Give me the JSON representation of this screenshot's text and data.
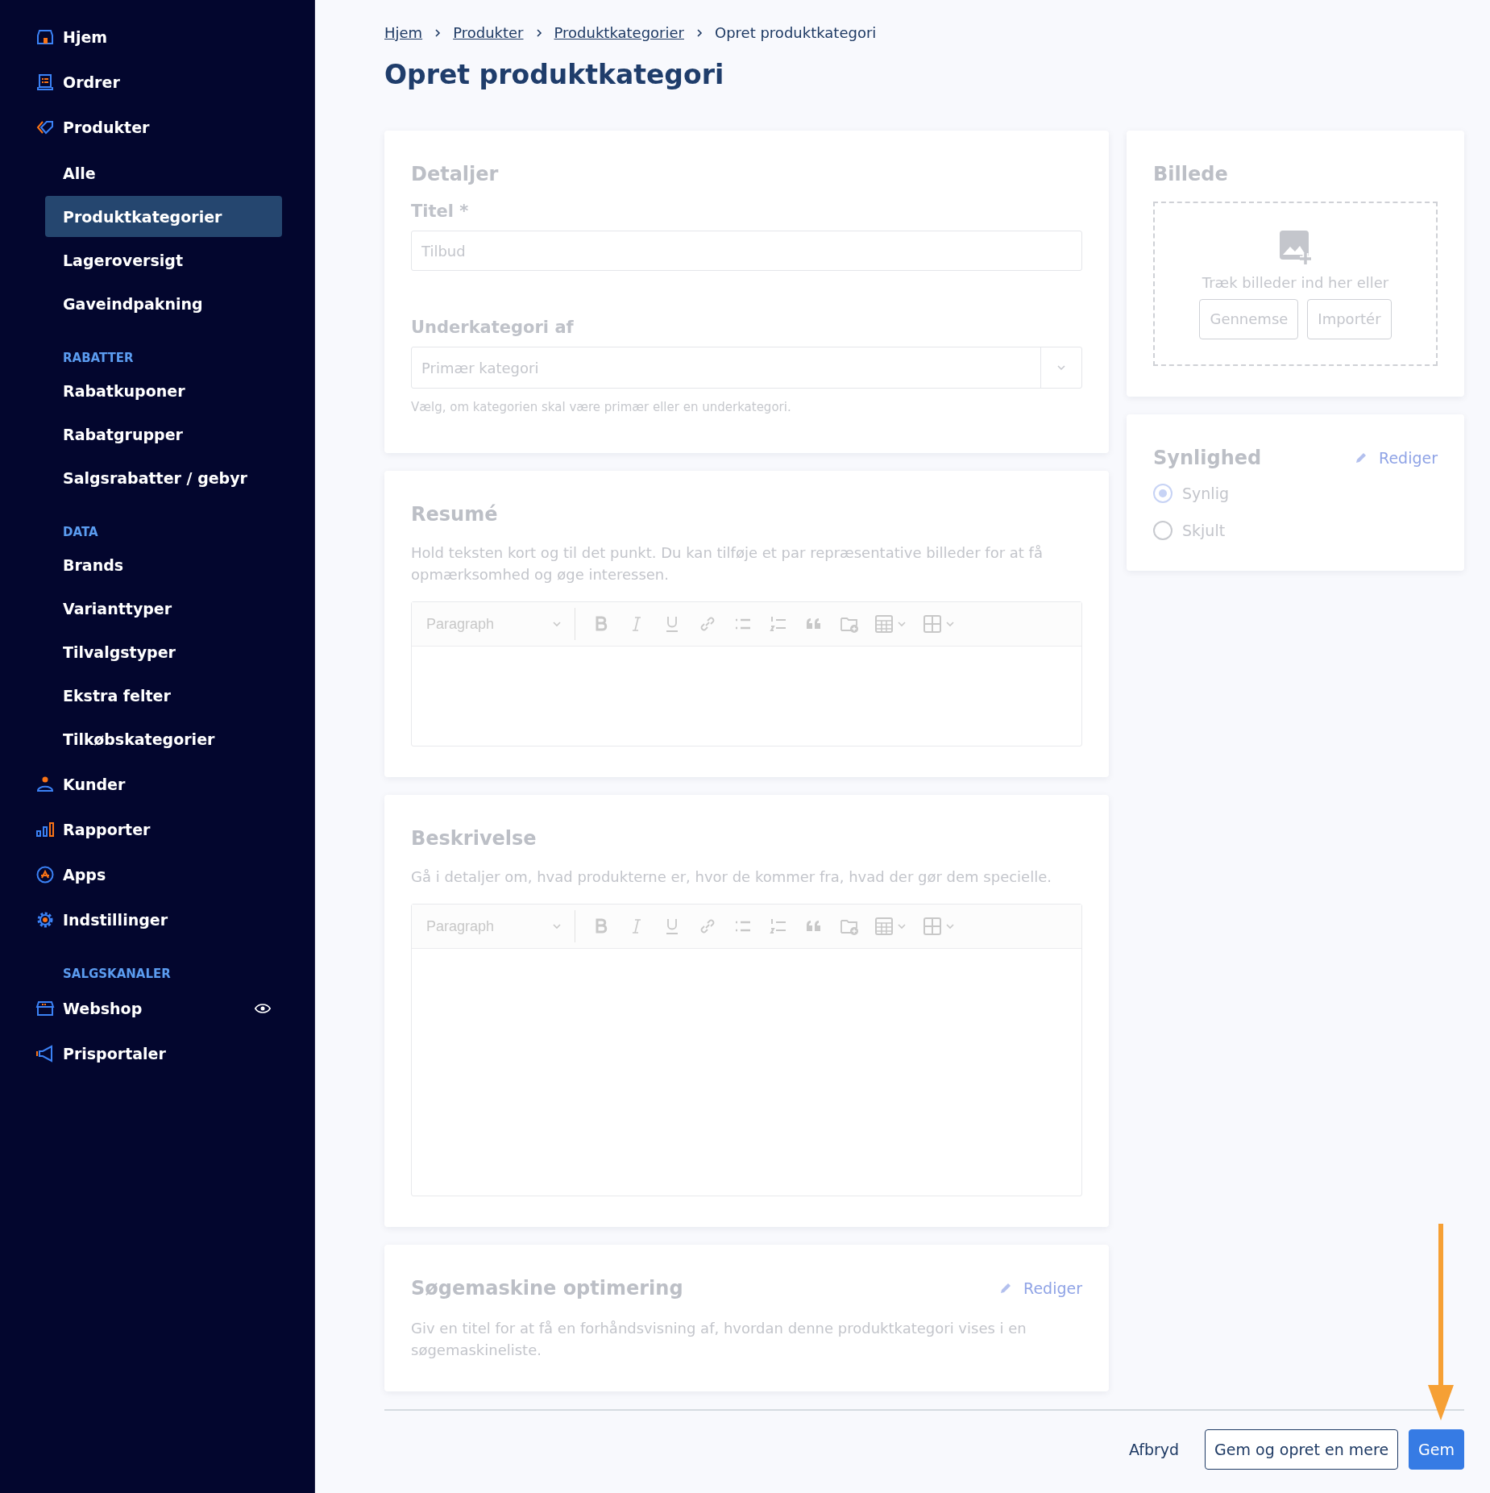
{
  "sidebar": {
    "sections": [
      {
        "items": [
          {
            "label": "Hjem",
            "selected": false,
            "visible": false
          },
          {
            "label": "Ordrer",
            "selected": false,
            "visible": false
          },
          {
            "label": "Produkter",
            "selected": false,
            "visible": false,
            "children": [
              {
                "label": "Alle",
                "selected": false
              },
              {
                "label": "Produktkategorier",
                "selected": true
              },
              {
                "label": "Lageroversigt",
                "selected": false
              },
              {
                "label": "Gaveindpakning",
                "selected": false
              }
            ]
          }
        ]
      },
      {
        "heading": "RABATTER",
        "sub": [
          {
            "label": "Rabatkuponer",
            "selected": false
          },
          {
            "label": "Rabatgrupper",
            "selected": false
          },
          {
            "label": "Salgsrabatter / gebyr",
            "selected": false
          }
        ]
      },
      {
        "heading": "DATA",
        "sub": [
          {
            "label": "Brands",
            "selected": false
          },
          {
            "label": "Varianttyper",
            "selected": false
          },
          {
            "label": "Tilvalgstyper",
            "selected": false
          },
          {
            "label": "Ekstra felter",
            "selected": false
          },
          {
            "label": "Tilkøbskategorier",
            "selected": false
          }
        ]
      },
      {
        "items": [
          {
            "label": "Kunder",
            "selected": false,
            "visible": false
          },
          {
            "label": "Rapporter",
            "selected": false,
            "visible": false
          },
          {
            "label": "Apps",
            "selected": false,
            "visible": false
          },
          {
            "label": "Indstillinger",
            "selected": false,
            "visible": false
          }
        ]
      },
      {
        "heading": "SALGSKANALER",
        "items": [
          {
            "label": "Webshop",
            "selected": false,
            "visible": true
          },
          {
            "label": "Prisportaler",
            "selected": false,
            "visible": false
          }
        ]
      }
    ]
  },
  "breadcrumb": [
    {
      "label": "Hjem",
      "link": true
    },
    {
      "label": "Produkter",
      "link": true
    },
    {
      "label": "Produktkategorier",
      "link": true
    },
    {
      "label": "Opret produktkategori",
      "link": false
    }
  ],
  "title": "Opret produktkategori",
  "details": {
    "title": "Detaljer",
    "fields": [
      {
        "kind": "text",
        "label": "Titel *",
        "placeholder": "Tilbud"
      },
      {
        "kind": "select",
        "label": "Underkategori af",
        "placeholder": "Primær kategori",
        "help": "Vælg, om kategorien skal være primær eller en underkategori."
      }
    ]
  },
  "editors": [
    {
      "title": "Resumé",
      "description": "Hold teksten kort og til det punkt. Du kan tilføje et par repræsentative billeder for at få opmærksomhed og øge interessen.",
      "format": "Paragraph"
    },
    {
      "title": "Beskrivelse",
      "description": "Gå i detaljer om, hvad produkterne er, hvor de kommer fra, hvad der gør dem specielle.",
      "format": "Paragraph"
    }
  ],
  "seo": {
    "title": "Søgemaskine optimering",
    "action": "Rediger",
    "description": "Giv en titel for at få en forhåndsvisning af, hvordan denne produktkategori vises i en søgemaskineliste."
  },
  "image": {
    "title": "Billede",
    "hint": "Træk billeder ind her eller",
    "buttons": [
      "Gennemse",
      "Importér"
    ]
  },
  "visibility": {
    "title": "Synlighed",
    "action": "Rediger",
    "options": [
      {
        "label": "Synlig",
        "selected": true
      },
      {
        "label": "Skjult",
        "selected": false
      }
    ]
  },
  "footer": {
    "buttons": [
      {
        "kind": "link",
        "label": "Afbryd"
      },
      {
        "kind": "outline",
        "label": "Gem og opret en mere"
      },
      {
        "kind": "primary",
        "label": "Gem"
      }
    ]
  }
}
